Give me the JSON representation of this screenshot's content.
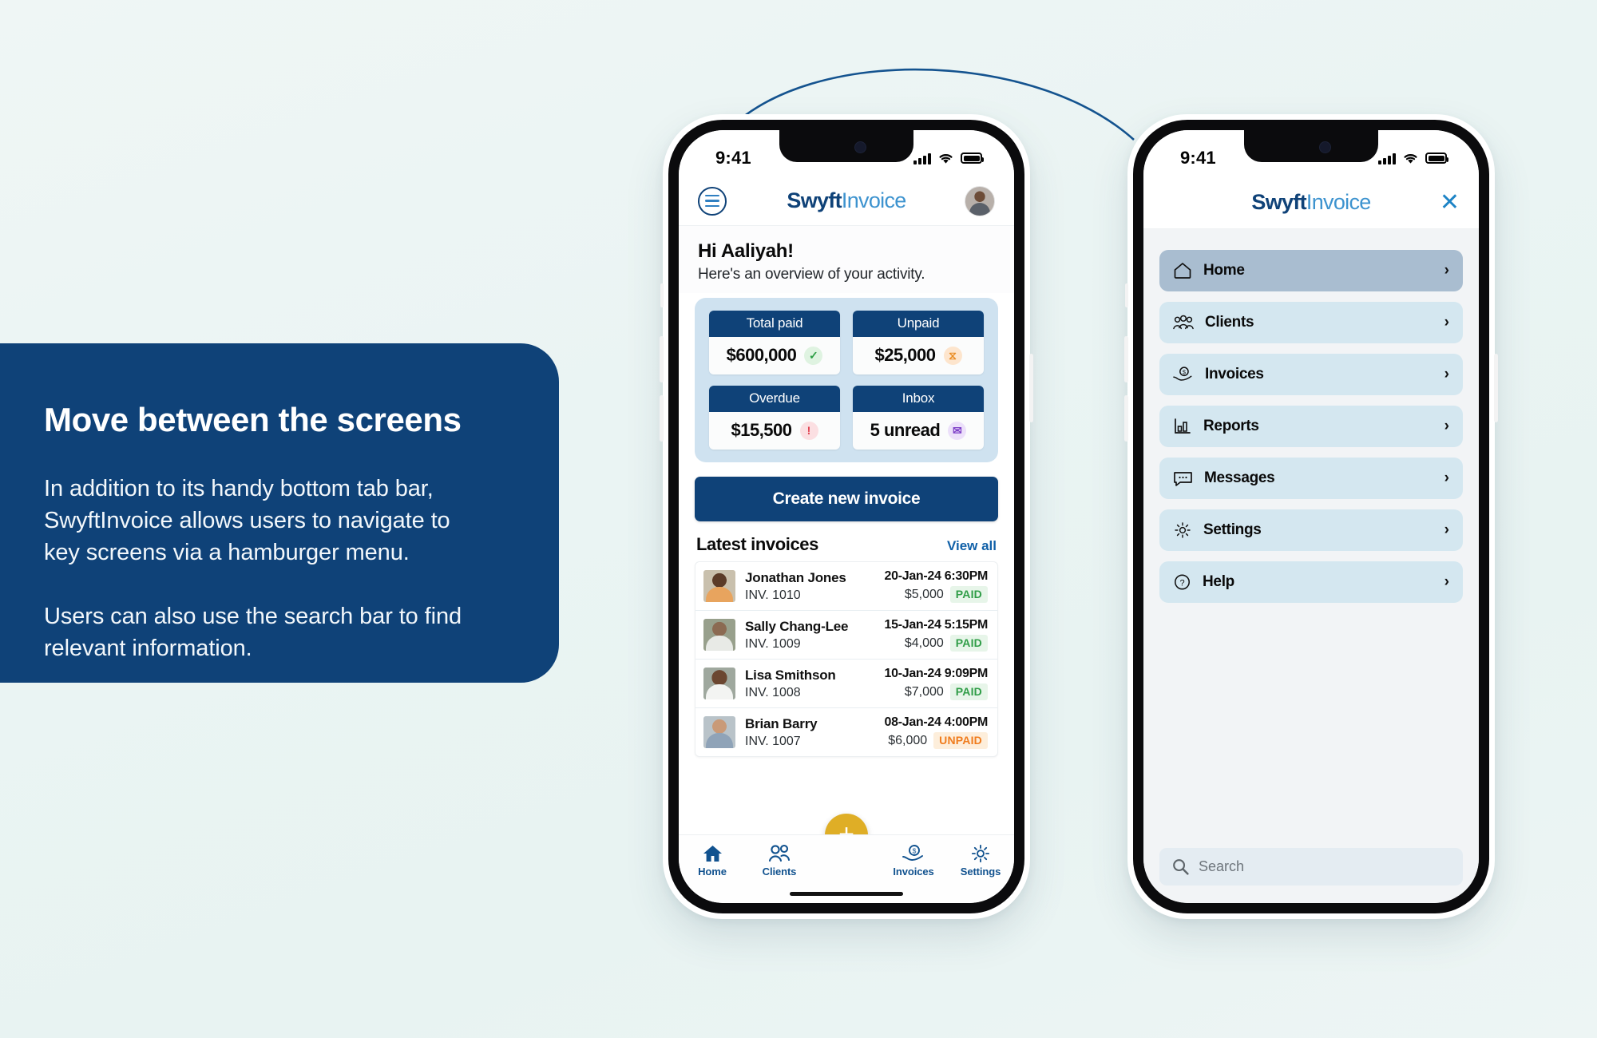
{
  "callout": {
    "title": "Move between the screens",
    "paragraph_1": "In addition to its handy bottom tab bar, SwyftInvoice allows users to navigate to key screens via a hamburger menu.",
    "paragraph_2": "Users can also use the search bar to find relevant information.",
    "bg_color": "#0f4278"
  },
  "brand": {
    "name_bold": "Swyft",
    "name_light": "Invoice",
    "navy": "#0f4278",
    "light_blue": "#3d93cf",
    "accent_gold": "#dfae26"
  },
  "phone_home": {
    "status": {
      "time": "9:41",
      "signal_icon": "signal-bars-icon",
      "wifi_icon": "wifi-icon",
      "battery_icon": "battery-icon"
    },
    "header": {
      "menu_icon": "hamburger-menu-icon",
      "avatar_icon": "user-avatar"
    },
    "greeting": {
      "title": "Hi Aaliyah!",
      "subtitle": "Here's an overview of your activity."
    },
    "stats": [
      {
        "label": "Total paid",
        "value": "$600,000",
        "badge_icon": "check-circle-icon",
        "badge_glyph": "✓",
        "badge_style": "badge-green"
      },
      {
        "label": "Unpaid",
        "value": "$25,000",
        "badge_icon": "hourglass-icon",
        "badge_glyph": "⧖",
        "badge_style": "badge-orange"
      },
      {
        "label": "Overdue",
        "value": "$15,500",
        "badge_icon": "alert-exclamation-icon",
        "badge_glyph": "!",
        "badge_style": "badge-red"
      },
      {
        "label": "Inbox",
        "value": "5 unread",
        "badge_icon": "message-bubble-icon",
        "badge_glyph": "✉",
        "badge_style": "badge-purple"
      }
    ],
    "cta_label": "Create new invoice",
    "invoices_section": {
      "title": "Latest invoices",
      "view_all_label": "View all"
    },
    "invoices": [
      {
        "avatar": "avatar-jonathan-jones",
        "name": "Jonathan Jones",
        "number": "INV. 1010",
        "date": "20-Jan-24 6:30PM",
        "amount": "$5,000",
        "status": "PAID",
        "status_style": "pill-paid"
      },
      {
        "avatar": "avatar-sally-chang-lee",
        "name": "Sally Chang-Lee",
        "number": "INV. 1009",
        "date": "15-Jan-24 5:15PM",
        "amount": "$4,000",
        "status": "PAID",
        "status_style": "pill-paid"
      },
      {
        "avatar": "avatar-lisa-smithson",
        "name": "Lisa Smithson",
        "number": "INV. 1008",
        "date": "10-Jan-24 9:09PM",
        "amount": "$7,000",
        "status": "PAID",
        "status_style": "pill-paid"
      },
      {
        "avatar": "avatar-brian-barry",
        "name": "Brian Barry",
        "number": "INV. 1007",
        "date": "08-Jan-24 4:00PM",
        "amount": "$6,000",
        "status": "UNPAID",
        "status_style": "pill-unpaid"
      }
    ],
    "tabs": [
      {
        "label": "Home",
        "icon": "home-icon"
      },
      {
        "label": "Clients",
        "icon": "people-icon"
      },
      {
        "label": "Invoices",
        "icon": "hand-coin-icon"
      },
      {
        "label": "Settings",
        "icon": "gear-icon"
      }
    ],
    "fab": {
      "label": "+",
      "icon": "plus-icon"
    }
  },
  "phone_menu": {
    "status": {
      "time": "9:41",
      "signal_icon": "signal-bars-icon",
      "wifi_icon": "wifi-icon",
      "battery_icon": "battery-icon"
    },
    "header": {
      "close_glyph": "✕",
      "close_icon": "close-icon"
    },
    "items": [
      {
        "label": "Home",
        "icon": "home-outline-icon",
        "chevron": "›",
        "active": true
      },
      {
        "label": "Clients",
        "icon": "people-outline-icon",
        "chevron": "›",
        "active": false
      },
      {
        "label": "Invoices",
        "icon": "hand-coin-icon",
        "chevron": "›",
        "active": false
      },
      {
        "label": "Reports",
        "icon": "bar-chart-icon",
        "chevron": "›",
        "active": false
      },
      {
        "label": "Messages",
        "icon": "chat-bubble-icon",
        "chevron": "›",
        "active": false
      },
      {
        "label": "Settings",
        "icon": "gear-outline-icon",
        "chevron": "›",
        "active": false
      },
      {
        "label": "Help",
        "icon": "question-circle-icon",
        "chevron": "›",
        "active": false
      }
    ],
    "search": {
      "placeholder": "Search",
      "icon": "search-icon"
    }
  }
}
